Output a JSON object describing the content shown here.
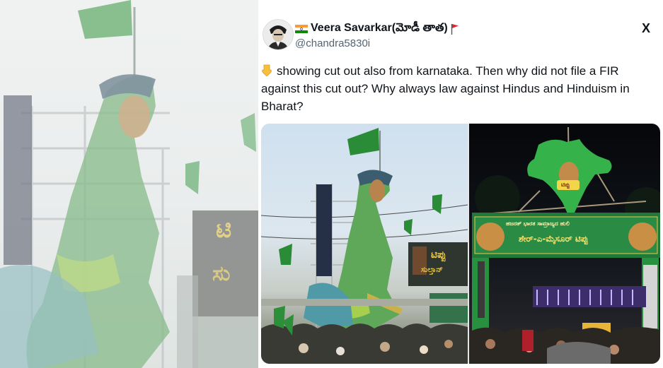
{
  "tweet": {
    "display_name": "Veera Savarkar(మోడీ తాత)",
    "handle": "@chandra5830i",
    "text": "showing  cut out also from karnataka. Then why did not file a FIR against this cut out? Why always law against Hindus and Hinduism in Bharat?",
    "platform_logo": "X",
    "icons": [
      "india-flag-icon",
      "red-flag-icon",
      "pointing-down-icon",
      "x-logo-icon"
    ]
  },
  "media": {
    "image1": {
      "banner_text": "ಟಿಪ್ಪು",
      "banner_text2": "ಸುಲ್ತಾನ್"
    },
    "image2": {
      "arch_text_top": "ಹಜರತ್ ಭಾರತ ಸಾಮ್ರಾಜ್ಯದ ಹುಲಿ",
      "arch_text_main": "ಶೇರ್-ಎ-ಮೈಸೂರ್ ಟಿಪ್ಪು",
      "portrait_text": "ಟಿಪ್ಪು"
    }
  },
  "background": {
    "banner_letter1": "ಟಿ",
    "banner_letter2": "ಸು"
  },
  "colors": {
    "text_primary": "#0f1419",
    "text_secondary": "#536471",
    "flag_green": "#2e9e3a"
  }
}
